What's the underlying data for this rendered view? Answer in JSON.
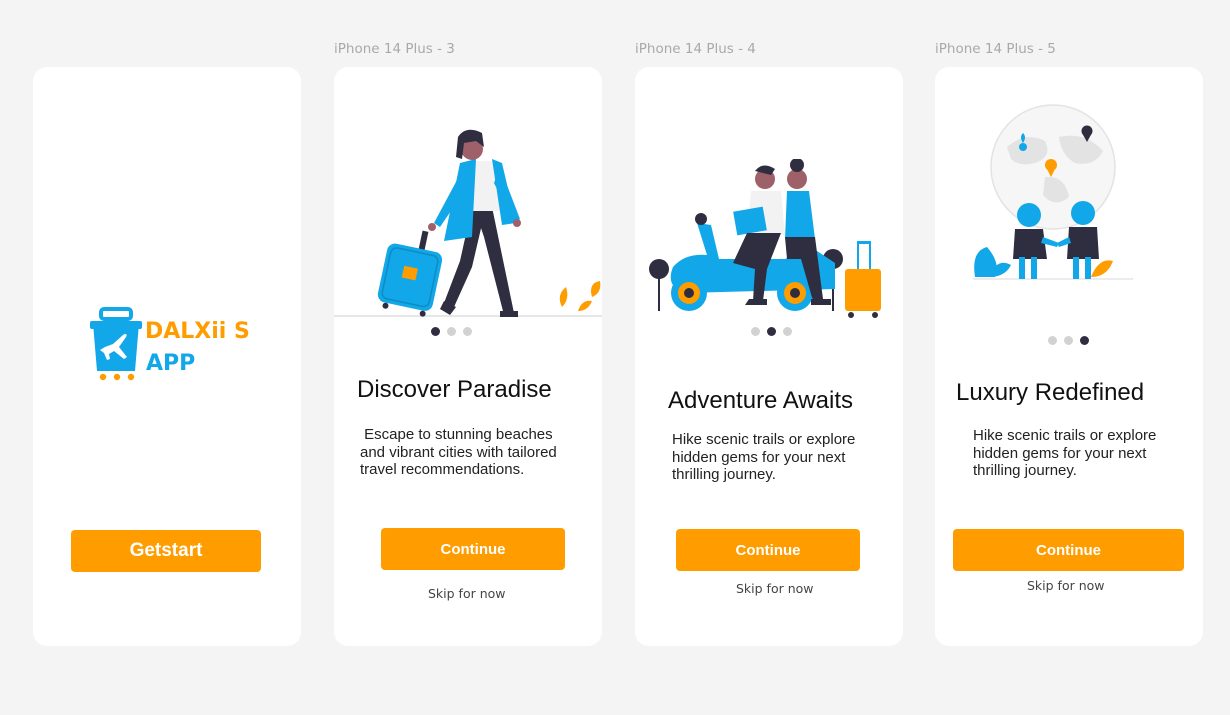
{
  "colors": {
    "accent": "#ff9c00",
    "brand_blue": "#12a7e8",
    "dot_active": "#2f2e41",
    "dot_inactive": "#d2d2d2"
  },
  "frames": [
    {
      "label": "",
      "logo": {
        "line1": "DALXii S",
        "line2": "APP"
      },
      "button": "Getstart"
    },
    {
      "label": "iPhone 14 Plus - 3",
      "illustration": "woman-walking-with-suitcase",
      "heading": "Discover Paradise",
      "description": " Escape to stunning beaches and vibrant cities with tailored travel recommendations.",
      "active_dot": 1,
      "button": "Continue",
      "skip": "Skip for now"
    },
    {
      "label": "iPhone 14 Plus - 4",
      "illustration": "couple-on-scooter",
      "heading": "Adventure Awaits",
      "description": "Hike scenic trails or explore hidden gems for your next thrilling journey.",
      "active_dot": 2,
      "button": "Continue",
      "skip": "Skip for now"
    },
    {
      "label": "iPhone 14 Plus - 5",
      "illustration": "people-with-globe-map-pins",
      "heading": "Luxury Redefined",
      "description": "Hike scenic trails or explore hidden gems for your next thrilling journey.",
      "active_dot": 3,
      "button": "Continue",
      "skip": "Skip for now"
    }
  ]
}
